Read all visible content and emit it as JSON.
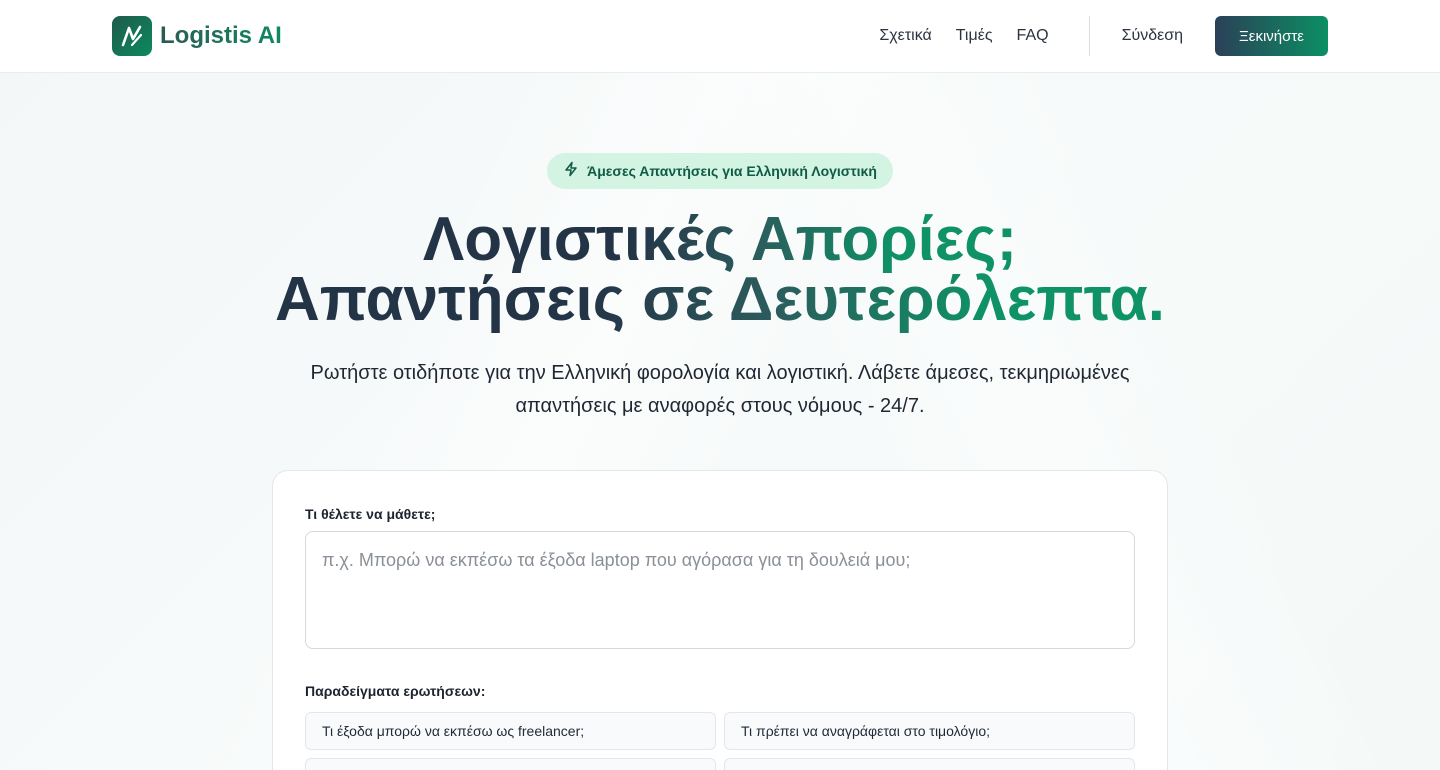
{
  "header": {
    "brand": "Logistis AI",
    "nav": {
      "about": "Σχετικά",
      "pricing": "Τιμές",
      "faq": "FAQ",
      "login": "Σύνδεση",
      "cta": "Ξεκινήστε"
    }
  },
  "hero": {
    "badge": "Άμεσες Απαντήσεις για Ελληνική Λογιστική",
    "badge_icon": "lightning-icon",
    "title_line1": "Λογιστικές Απορίες;",
    "title_line2": "Απαντήσεις σε Δευτερόλεπτα.",
    "subtitle_line1": "Ρωτήστε οτιδήποτε για την Ελληνική φορολογία και λογιστική. Λάβετε άμεσες, τεκμηριωμένες",
    "subtitle_line2": "απαντήσεις με αναφορές στους νόμους - 24/7."
  },
  "ask": {
    "label": "Τι θέλετε να μάθετε;",
    "placeholder": "π.χ. Μπορώ να εκπέσω τα έξοδα laptop που αγόρασα για τη δουλειά μου;",
    "value": "",
    "examples_label": "Παραδείγματα ερωτήσεων:",
    "examples": [
      "Τι έξοδα μπορώ να εκπέσω ως freelancer;",
      "Τι πρέπει να αναγράφεται στο τιμολόγιο;",
      "",
      ""
    ]
  },
  "colors": {
    "brand_dark": "#243447",
    "brand_green": "#0f9266",
    "badge_bg": "#d3f3e3",
    "badge_text": "#0f5b43"
  }
}
